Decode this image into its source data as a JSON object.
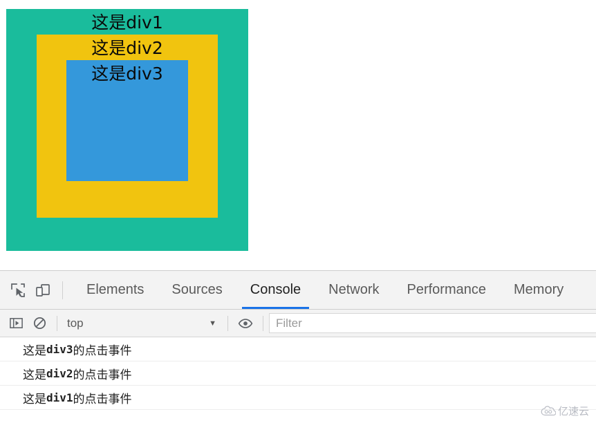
{
  "page": {
    "div1": {
      "label": "这是div1",
      "color": "#1abc9c"
    },
    "div2": {
      "label": "这是div2",
      "color": "#f1c40f"
    },
    "div3": {
      "label": "这是div3",
      "color": "#3498db"
    }
  },
  "devtools": {
    "toolbar_icons": [
      {
        "name": "inspect-element-icon",
        "glyph": "inspect"
      },
      {
        "name": "device-toolbar-icon",
        "glyph": "device"
      }
    ],
    "tabs": [
      {
        "label": "Elements",
        "active": false
      },
      {
        "label": "Sources",
        "active": false
      },
      {
        "label": "Console",
        "active": true
      },
      {
        "label": "Network",
        "active": false
      },
      {
        "label": "Performance",
        "active": false
      },
      {
        "label": "Memory",
        "active": false
      }
    ],
    "active_tab": "Console",
    "accent_color": "#1a73e8",
    "console_toolbar": {
      "sidebar_toggle_icon": "console-sidebar-icon",
      "clear_console_icon": "clear-console-icon",
      "eye_icon": "live-expression-icon",
      "context": "top",
      "context_caret": "▼",
      "filter_placeholder": "Filter",
      "filter_value": ""
    },
    "console_messages": [
      {
        "prefix": "这是",
        "code": "div3",
        "suffix": "的点击事件"
      },
      {
        "prefix": "这是",
        "code": "div2",
        "suffix": "的点击事件"
      },
      {
        "prefix": "这是",
        "code": "div1",
        "suffix": "的点击事件"
      }
    ]
  },
  "watermark": {
    "text": "亿速云"
  }
}
